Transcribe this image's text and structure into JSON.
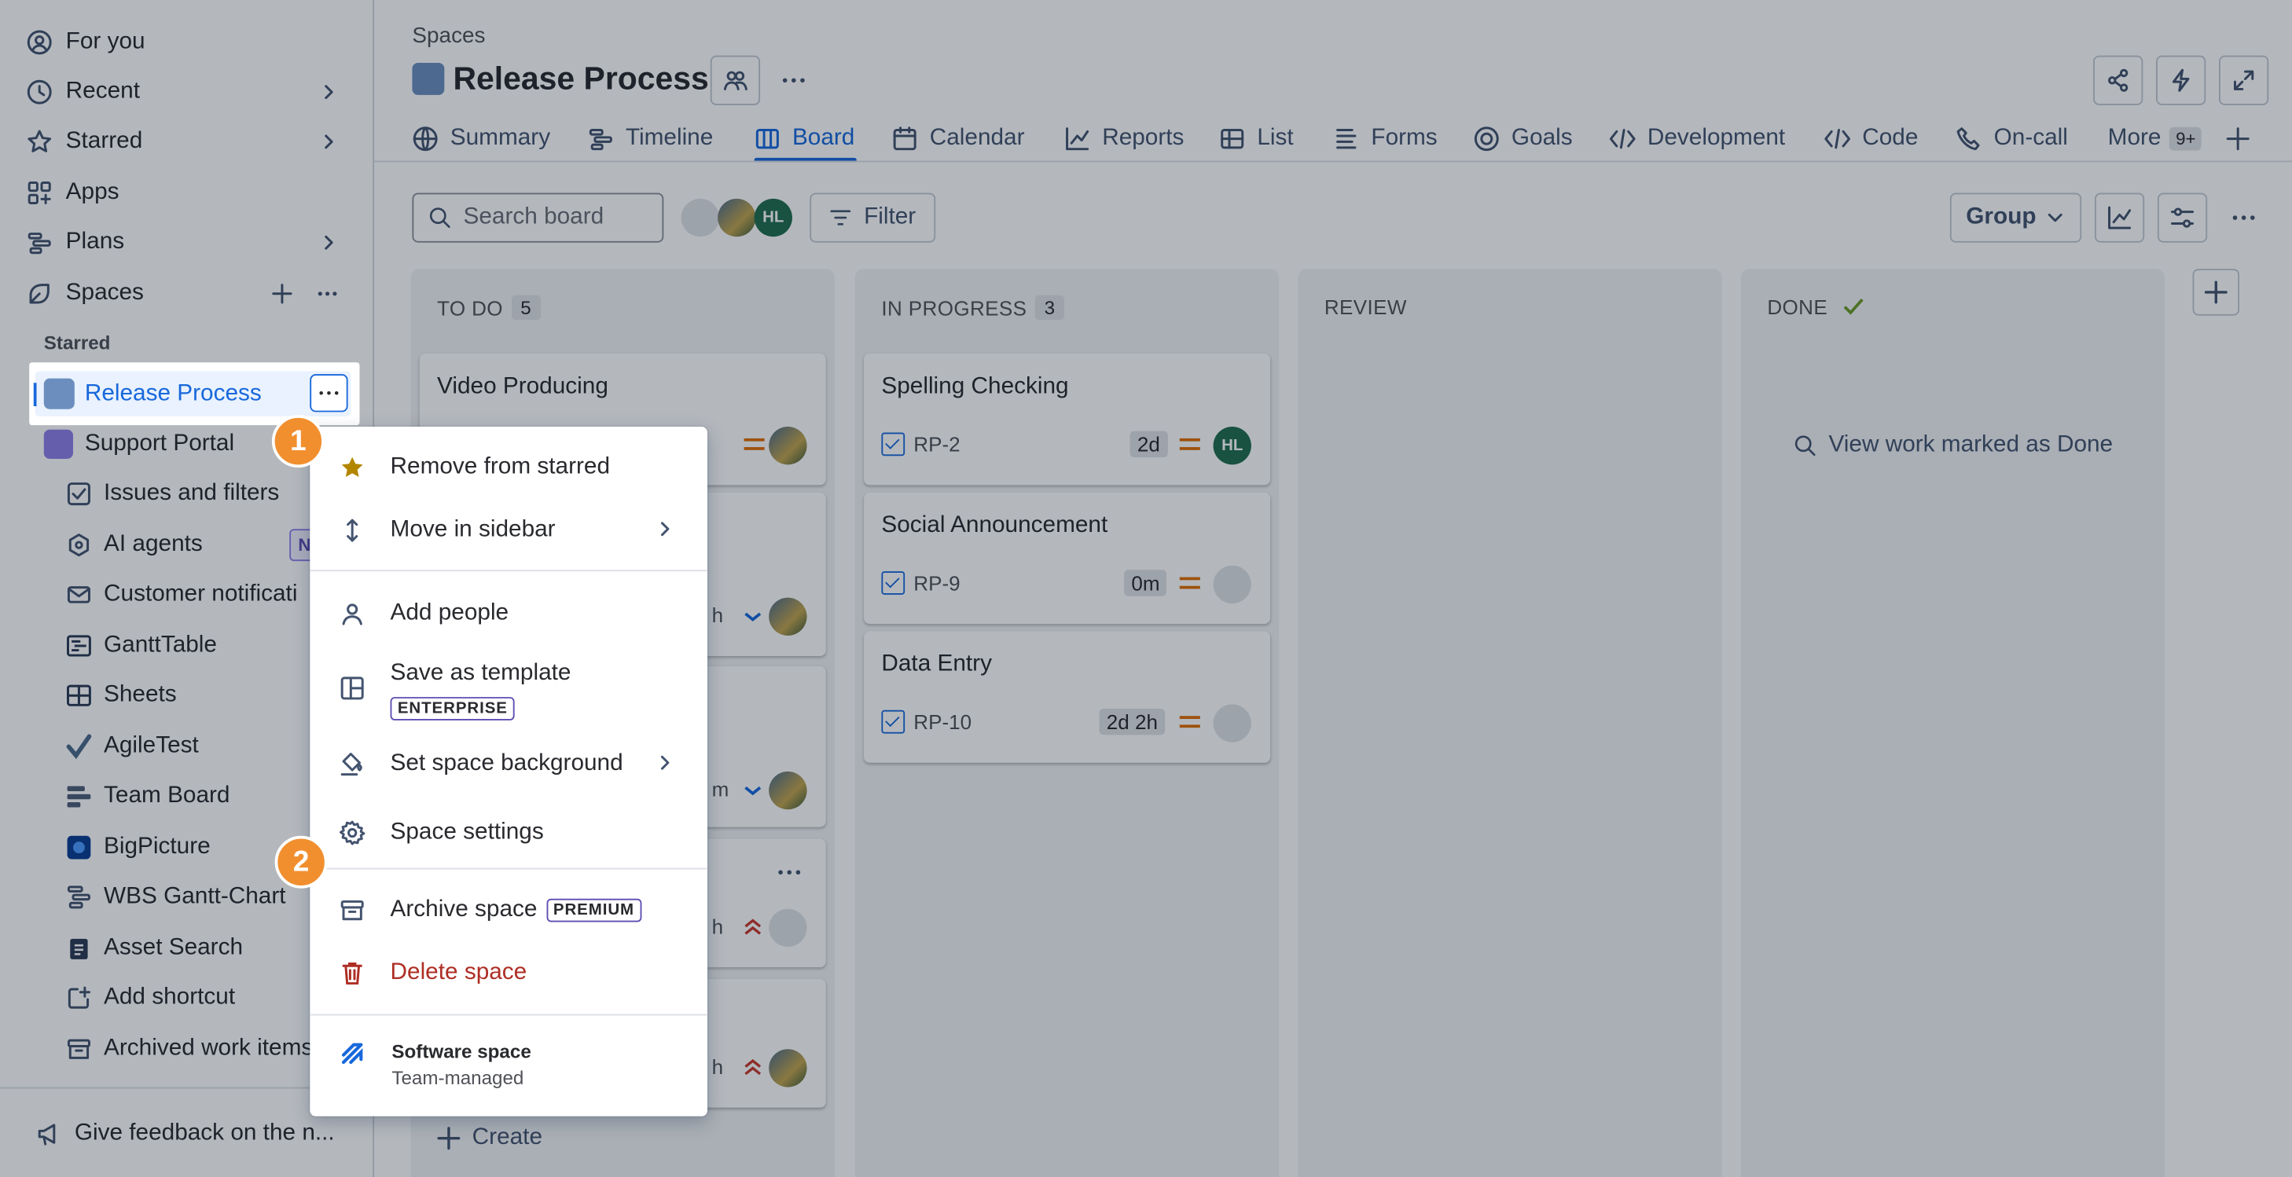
{
  "sidebar": {
    "nav": [
      {
        "label": "For you",
        "icon": "user-circle-icon"
      },
      {
        "label": "Recent",
        "icon": "clock-icon"
      },
      {
        "label": "Starred",
        "icon": "star-icon"
      },
      {
        "label": "Apps",
        "icon": "apps-icon"
      },
      {
        "label": "Plans",
        "icon": "plans-icon"
      },
      {
        "label": "Spaces",
        "icon": "spaces-icon"
      }
    ],
    "starred_heading": "Starred",
    "release_process": "Release Process",
    "support_portal": "Support Portal",
    "sub_items": [
      {
        "label": "Issues and filters",
        "icon": "filter-icon"
      },
      {
        "label": "AI agents",
        "icon": "ai-agent-icon"
      },
      {
        "label": "Customer notificati",
        "icon": "mail-icon"
      },
      {
        "label": "GanttTable",
        "icon": "gantt-table-icon"
      },
      {
        "label": "Sheets",
        "icon": "sheets-icon"
      },
      {
        "label": "AgileTest",
        "icon": "agiletest-icon"
      },
      {
        "label": "Team Board",
        "icon": "team-board-icon"
      },
      {
        "label": "BigPicture",
        "icon": "bigpicture-icon"
      },
      {
        "label": "WBS Gantt-Chart",
        "icon": "wbs-gantt-icon"
      },
      {
        "label": "Asset Search",
        "icon": "asset-search-icon"
      },
      {
        "label": "Add shortcut",
        "icon": "add-shortcut-icon"
      },
      {
        "label": "Archived work items",
        "icon": "archive-icon"
      }
    ],
    "new_badge": "N",
    "feedback": "Give feedback on the n..."
  },
  "header": {
    "breadcrumb": "Spaces",
    "title": "Release Process"
  },
  "tabs": [
    {
      "label": "Summary",
      "icon": "globe-icon"
    },
    {
      "label": "Timeline",
      "icon": "timeline-icon"
    },
    {
      "label": "Board",
      "icon": "board-icon",
      "active": true
    },
    {
      "label": "Calendar",
      "icon": "calendar-icon"
    },
    {
      "label": "Reports",
      "icon": "reports-icon"
    },
    {
      "label": "List",
      "icon": "list-icon"
    },
    {
      "label": "Forms",
      "icon": "forms-icon"
    },
    {
      "label": "Goals",
      "icon": "goals-icon"
    },
    {
      "label": "Development",
      "icon": "development-icon"
    },
    {
      "label": "Code",
      "icon": "code-icon"
    },
    {
      "label": "On-call",
      "icon": "on-call-icon"
    }
  ],
  "more_tab": {
    "label": "More",
    "badge": "9+"
  },
  "toolbar": {
    "search_placeholder": "Search board",
    "filter_label": "Filter",
    "group_label": "Group",
    "avatar_initials": "HL"
  },
  "columns": [
    {
      "name": "TO DO",
      "count": "5"
    },
    {
      "name": "IN PROGRESS",
      "count": "3"
    },
    {
      "name": "REVIEW",
      "count": ""
    },
    {
      "name": "DONE",
      "count": ""
    }
  ],
  "todo_cards": [
    {
      "title": "Video Producing"
    }
  ],
  "todo_partial_estimates": [
    "h",
    "m",
    "h",
    "h"
  ],
  "create_label": "Create",
  "inprogress_cards": [
    {
      "title": "Spelling Checking",
      "key": "RP-2",
      "estimate": "2d",
      "assignee": "HL"
    },
    {
      "title": "Social Announcement",
      "key": "RP-9",
      "estimate": "0m",
      "assignee": ""
    },
    {
      "title": "Data Entry",
      "key": "RP-10",
      "estimate": "2d 2h",
      "assignee": ""
    }
  ],
  "done_link": "View work marked as Done",
  "menu": {
    "remove_starred": "Remove from starred",
    "move_sidebar": "Move in sidebar",
    "add_people": "Add people",
    "save_template": "Save as template",
    "enterprise": "ENTERPRISE",
    "set_background": "Set space background",
    "space_settings": "Space settings",
    "archive_space": "Archive space",
    "premium": "PREMIUM",
    "delete_space": "Delete space",
    "software_space": "Software space",
    "team_managed": "Team-managed"
  },
  "steps": [
    "1",
    "2"
  ],
  "colors": {
    "accent": "#1868db",
    "step": "#f18f2f",
    "danger": "#ae2e24",
    "star": "#b38600"
  }
}
